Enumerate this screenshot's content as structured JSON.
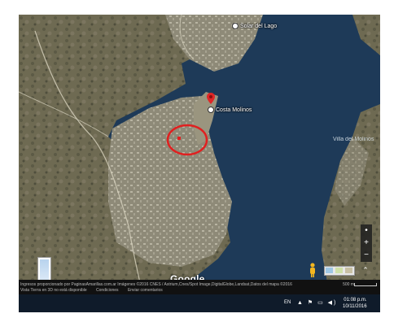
{
  "map": {
    "places": {
      "solar": "Solar del Lago",
      "costa": "Costa Molinos",
      "villa": "Villa del Molinos"
    },
    "logo": "Google",
    "controls": {
      "zoom_in": "+",
      "zoom_out": "−",
      "expand": "⌃"
    },
    "footer": {
      "attribution": "Ingresos proporcionado por PaginasAmarillas.com.ar    Imágenes ©2016 CNES / Astrium,Cnes/Spot Image,DigitalGlobe,Landsat,Datos del mapa ©2016",
      "links": [
        "Vista Tierra en 3D no está disponible",
        "Condiciones",
        "Enviar comentarios"
      ],
      "scale": "500 m"
    },
    "colors": {
      "water": "#1e3a58",
      "marker": "#e02626",
      "circle": "#e02020"
    }
  },
  "taskbar": {
    "lang": "EN",
    "tray": "▲ ⚑ ▭ ◀)",
    "time": "01:08 p.m.",
    "date": "10/11/2016"
  }
}
